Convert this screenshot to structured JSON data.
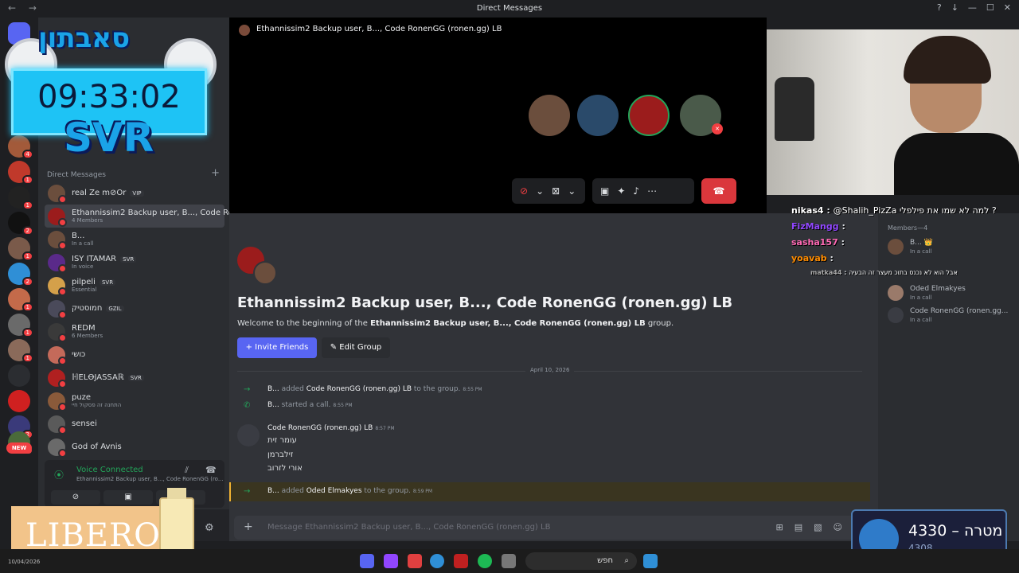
{
  "window": {
    "title": "Direct Messages"
  },
  "overlay": {
    "hebrew_title": "סאבתון",
    "timer": "09:33:02",
    "svr": "SVR",
    "sponsor": "LIBERO"
  },
  "servers": {
    "badges": [
      "4",
      "1",
      "1",
      "2",
      "1",
      "2",
      "1",
      "1",
      "1",
      "2",
      "2"
    ],
    "new_label": "NEW"
  },
  "dm_panel": {
    "header": "Direct Messages",
    "items": [
      {
        "name": "real Ze m⊘Or",
        "tag": "VIP",
        "sub": ""
      },
      {
        "name": "Ethannissim2 Backup user, B..., Code Ro...",
        "tag": "",
        "sub": "4 Members"
      },
      {
        "name": "B...",
        "tag": "",
        "sub": "In a call"
      },
      {
        "name": "ISY ITAMAR",
        "tag": "SVR",
        "sub": "In voice"
      },
      {
        "name": "pilpeli",
        "tag": "SVR",
        "sub": "Essential"
      },
      {
        "name": "חמוסטיק",
        "tag": "GZIL",
        "sub": ""
      },
      {
        "name": "REDM",
        "tag": "",
        "sub": "6 Members"
      },
      {
        "name": "כושי",
        "tag": "",
        "sub": ""
      },
      {
        "name": "ℍELꝊJASSAℝ",
        "tag": "SVR",
        "sub": ""
      },
      {
        "name": "puze",
        "tag": "",
        "sub": "התחנה זה פסקול חיי"
      },
      {
        "name": "sensei",
        "tag": "",
        "sub": ""
      },
      {
        "name": "God of Avnis",
        "tag": "",
        "sub": ""
      }
    ]
  },
  "voice": {
    "status": "Voice Connected",
    "channel": "Ethannissim2 Backup user, B..., Code RonenGG (ro..."
  },
  "call": {
    "title": "Ethannissim2 Backup user, B..., Code RonenGG (ronen.gg) LB"
  },
  "chat": {
    "group_title": "Ethannissim2 Backup user, B..., Code RonenGG (ronen.gg) LB",
    "welcome_prefix": "Welcome to the beginning of the ",
    "welcome_group": "Ethannissim2 Backup user, B..., Code RonenGG (ronen.gg) LB",
    "welcome_suffix": " group.",
    "invite_label": "Invite Friends",
    "edit_label": "Edit Group",
    "date": "April 10, 2026",
    "sys1": {
      "actor": "B...",
      "text1": " added ",
      "target": "Code RonenGG (ronen.gg) LB",
      "text2": " to the group.",
      "time": "8:55 PM"
    },
    "sys2": {
      "actor": "B...",
      "text": " started a call.",
      "time": "8:55 PM"
    },
    "msg": {
      "author": "Code RonenGG (ronen.gg) LB",
      "time": "8:57 PM",
      "lines": [
        "עומר זית",
        "זילברמן",
        "אורי לזרוב"
      ]
    },
    "sys3": {
      "actor": "B...",
      "text1": " added ",
      "target": "Oded Elmakyes",
      "text2": " to the group.",
      "time": "8:59 PM"
    },
    "input_placeholder": "Message Ethannissim2 Backup user, B..., Code RonenGG (ronen.gg) LB"
  },
  "members": {
    "header": "Members—4",
    "items": [
      {
        "name": "B... 👑",
        "sub": "In a call"
      },
      {
        "name": "Oded Elmakyes",
        "sub": "In a call"
      },
      {
        "name": "Code RonenGG (ronen.gg...",
        "sub": "In a call"
      }
    ]
  },
  "twitch_chat": [
    {
      "user": "nikas4",
      "color": "#ffffff",
      "msg": "@Shalih_PizZa למה לא שמו את פילפלי ?"
    },
    {
      "user": "FizMangg",
      "color": "#9147ff",
      "msg": ""
    },
    {
      "user": "sasha157",
      "color": "#ff69b4",
      "msg": ""
    },
    {
      "user": "yoavab",
      "color": "#ff8c00",
      "msg": ""
    },
    {
      "user": "matka44",
      "color": "#aaaaaa",
      "msg": "אבל הוא לא נכנס בתוכ מעצר זה הבעיה"
    }
  ],
  "goal": {
    "current": "4330",
    "label": "מטרה",
    "target": "4308"
  },
  "taskbar": {
    "search_placeholder": "חפש",
    "date": "10/04/2026"
  }
}
